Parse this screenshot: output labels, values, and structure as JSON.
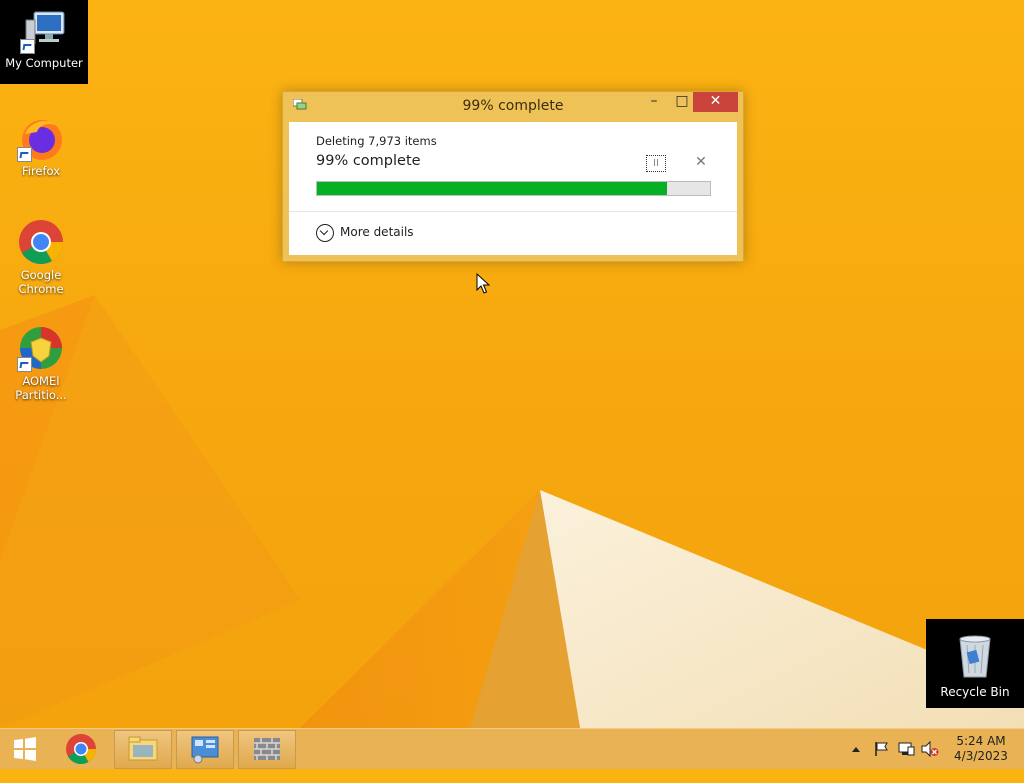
{
  "desktop_icons": [
    {
      "label": "My Computer",
      "icon": "computer-icon"
    },
    {
      "label": "Firefox",
      "icon": "firefox-icon"
    },
    {
      "label": "Google Chrome",
      "icon": "chrome-icon"
    },
    {
      "label": "AOMEI Partitio...",
      "icon": "aomei-icon"
    }
  ],
  "dialog": {
    "title": "99% complete",
    "operation": "Deleting 7,973 items",
    "status": "99% complete",
    "progress": 0.89,
    "more_details_label": "More details",
    "minimize_glyph": "–",
    "maximize_glyph": "□",
    "close_glyph": "✕",
    "cancel_glyph": "✕",
    "pause_glyph": "II"
  },
  "recycle_bin": {
    "label": "Recycle Bin",
    "icon": "recycle-bin-icon"
  },
  "taskbar": {
    "items": [
      "start-button",
      "chrome",
      "file-explorer",
      "control-panel",
      "firewall"
    ],
    "clock": {
      "time": "5:24 AM",
      "date": "4/3/2023"
    },
    "tray_icons": [
      "show-hidden-icons",
      "flag-icon",
      "network-icon",
      "volume-muted-icon"
    ]
  },
  "colors": {
    "accent": "#f3a20c",
    "progress_fill": "#06b025",
    "close_button": "#c9453b",
    "dialog_frame": "#efc257"
  }
}
